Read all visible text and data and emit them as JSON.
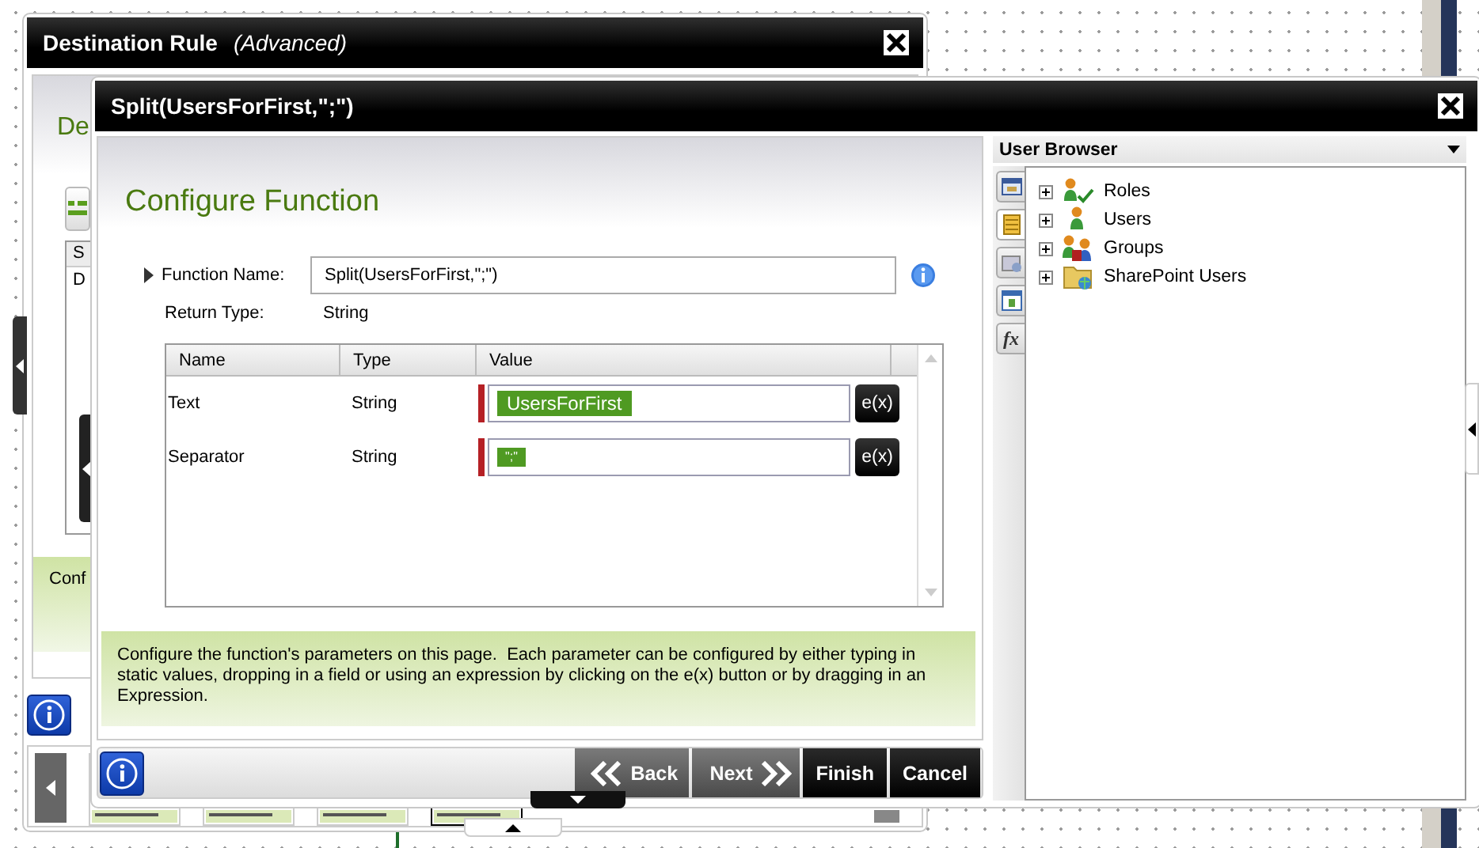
{
  "background_window": {
    "title": "Destination Rule",
    "subtitle": "(Advanced)",
    "heading": "De",
    "table_header": "S",
    "table_cell": "D",
    "help": "Conf"
  },
  "dialog": {
    "title": "Split(UsersForFirst,\";\")",
    "heading": "Configure Function",
    "function_name": {
      "label": "Function Name:",
      "value": "Split(UsersForFirst,\";\")"
    },
    "return_type": {
      "label": "Return Type:",
      "value": "String"
    },
    "parameters": {
      "columns": [
        "Name",
        "Type",
        "Value"
      ],
      "rows": [
        {
          "name": "Text",
          "type": "String",
          "value": "UsersForFirst",
          "required": true,
          "button": "e(x)"
        },
        {
          "name": "Separator",
          "type": "String",
          "value": "\";\"",
          "required": true,
          "button": "e(x)"
        }
      ]
    },
    "help": "Configure the function's parameters on this page.  Each parameter can be configured by either typing in static values, dropping in a field or using an expression by clicking on the e(x) button or by dragging in an Expression.",
    "buttons": [
      {
        "label": "Back",
        "kind": "back",
        "disabled": true
      },
      {
        "label": "Next",
        "kind": "next",
        "disabled": true
      },
      {
        "label": "Finish",
        "kind": "plain",
        "disabled": false
      },
      {
        "label": "Cancel",
        "kind": "plain",
        "disabled": false
      }
    ]
  },
  "user_browser": {
    "title": "User Browser",
    "tabs": [
      {
        "kind": "window",
        "selected": false
      },
      {
        "kind": "notebook",
        "selected": true
      },
      {
        "kind": "folders",
        "selected": false
      },
      {
        "kind": "form",
        "selected": false
      },
      {
        "kind": "function",
        "label": "fx",
        "selected": false
      }
    ],
    "tree": [
      {
        "label": "Roles",
        "kind": "roles",
        "expanded": false
      },
      {
        "label": "Users",
        "kind": "user",
        "expanded": false
      },
      {
        "label": "Groups",
        "kind": "group",
        "expanded": false
      },
      {
        "label": "SharePoint Users",
        "kind": "sharepoint",
        "expanded": false
      }
    ]
  }
}
